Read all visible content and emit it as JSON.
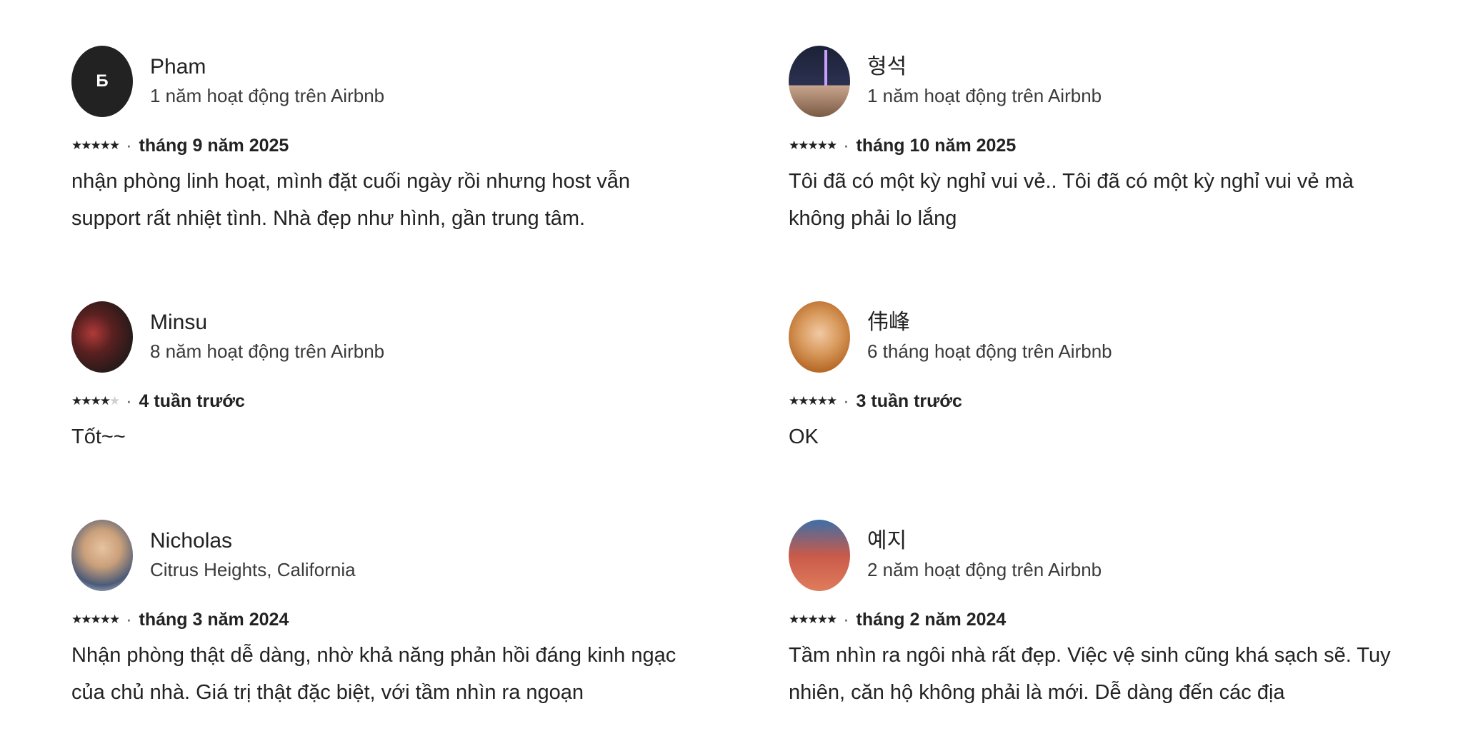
{
  "reviews": [
    {
      "name": "Pham",
      "avatar_letter": "Б",
      "avatar": "letter-avatar",
      "subtitle": "1 năm hoạt động trên Airbnb",
      "rating": 5,
      "stars": "★★★★★",
      "stars_off": "",
      "date": "tháng 9 năm 2025",
      "text": "nhận phòng linh hoạt, mình đặt cuối ngày rồi nhưng host vẫn support rất nhiệt tình. Nhà đẹp như hình, gần trung tâm."
    },
    {
      "name": "형석",
      "avatar_letter": "",
      "avatar": "photo-avatar",
      "subtitle": "1 năm hoạt động trên Airbnb",
      "rating": 5,
      "stars": "★★★★★",
      "stars_off": "",
      "date": "tháng 10 năm 2025",
      "text": "Tôi đã có một kỳ nghỉ vui vẻ.. Tôi đã có một kỳ nghỉ vui vẻ mà không phải lo lắng"
    },
    {
      "name": "Minsu",
      "avatar_letter": "",
      "avatar": "photo-avatar",
      "subtitle": "8 năm hoạt động trên Airbnb",
      "rating": 4,
      "stars": "★★★★",
      "stars_off": "★",
      "date": "4 tuần trước",
      "text": "Tốt~~"
    },
    {
      "name": "伟峰",
      "avatar_letter": "",
      "avatar": "photo-avatar",
      "subtitle": "6 tháng hoạt động trên Airbnb",
      "rating": 5,
      "stars": "★★★★★",
      "stars_off": "",
      "date": "3 tuần trước",
      "text": "OK"
    },
    {
      "name": "Nicholas",
      "avatar_letter": "",
      "avatar": "photo-avatar",
      "subtitle": "Citrus Heights, California",
      "rating": 5,
      "stars": "★★★★★",
      "stars_off": "",
      "date": "tháng 3 năm 2024",
      "text": "Nhận phòng thật dễ dàng, nhờ khả năng phản hồi đáng kinh ngạc của chủ nhà. Giá trị thật đặc biệt, với tầm nhìn ra ngoạn"
    },
    {
      "name": "예지",
      "avatar_letter": "",
      "avatar": "photo-avatar",
      "subtitle": "2 năm hoạt động trên Airbnb",
      "rating": 5,
      "stars": "★★★★★",
      "stars_off": "",
      "date": "tháng 2 năm 2024",
      "text": "Tầm nhìn ra ngôi nhà rất đẹp. Việc vệ sinh cũng khá sạch sẽ. Tuy nhiên, căn hộ không phải là mới. Dễ dàng đến các địa"
    }
  ],
  "separator": "·"
}
